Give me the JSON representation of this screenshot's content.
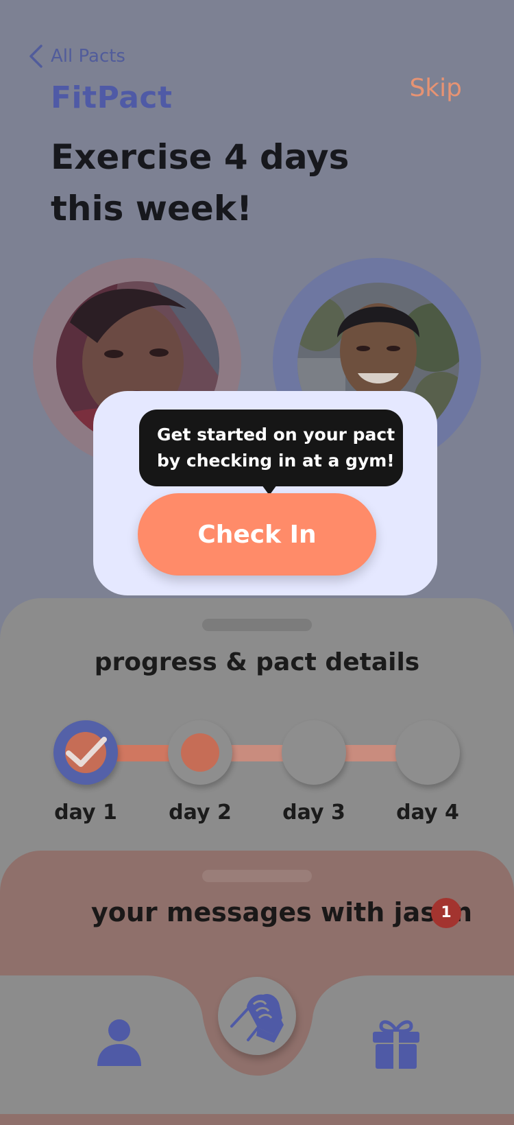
{
  "header": {
    "back_label": "All Pacts",
    "app_name": "FitPact",
    "skip_label": "Skip"
  },
  "pact": {
    "goal": "Exercise 4 days this week!"
  },
  "checkin": {
    "tooltip": "Get started on your pact by checking in at a gym!",
    "button_label": "Check In"
  },
  "progress": {
    "title": "progress & pact details",
    "days": [
      {
        "label": "day 1",
        "status": "completed"
      },
      {
        "label": "day 2",
        "status": "current"
      },
      {
        "label": "day 3",
        "status": "upcoming"
      },
      {
        "label": "day 4",
        "status": "upcoming"
      }
    ]
  },
  "messages": {
    "title": "your messages with jason",
    "unread_count": "1"
  },
  "nav": {
    "items": [
      "person-icon",
      "handshake-icon",
      "gift-icon"
    ]
  },
  "colors": {
    "brand": "#4f5aa6",
    "accent": "#ff8b69",
    "skip": "#e79373",
    "badge": "#a3342f"
  }
}
